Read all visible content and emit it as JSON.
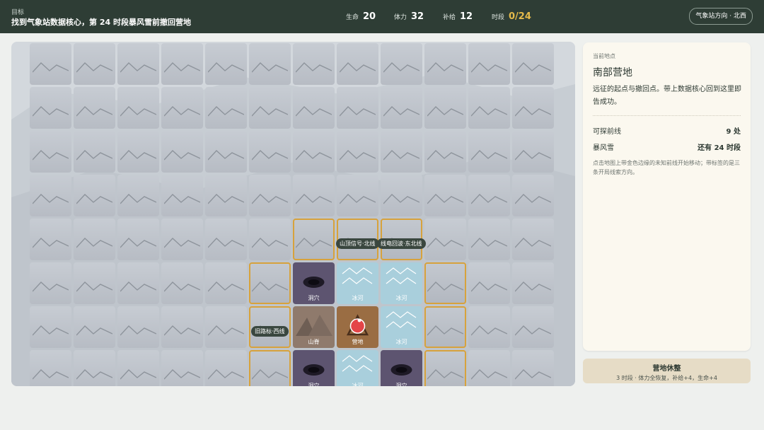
{
  "header": {
    "goal_label": "目标",
    "goal_text": "找到气象站数据核心，第 24 时段暴风雪前撤回营地",
    "stats": [
      {
        "label": "生命",
        "value": "20",
        "highlight": false
      },
      {
        "label": "体力",
        "value": "32",
        "highlight": false
      },
      {
        "label": "补给",
        "value": "12",
        "highlight": false
      },
      {
        "label": "时段",
        "value": "0/24",
        "highlight": true
      }
    ],
    "direction_hint": "气象站方向 · 北西"
  },
  "map": {
    "rows": 8,
    "cols": 12,
    "special_tiles": [
      {
        "row": 4,
        "col": 6,
        "type": "front",
        "label": ""
      },
      {
        "row": 4,
        "col": 7,
        "type": "front",
        "label": ""
      },
      {
        "row": 4,
        "col": 8,
        "type": "front",
        "label": ""
      },
      {
        "row": 5,
        "col": 5,
        "type": "front",
        "label": ""
      },
      {
        "row": 5,
        "col": 6,
        "type": "cave",
        "label": "洞穴"
      },
      {
        "row": 5,
        "col": 7,
        "type": "ice",
        "label": "冰河"
      },
      {
        "row": 5,
        "col": 8,
        "type": "ice",
        "label": "冰河"
      },
      {
        "row": 5,
        "col": 9,
        "type": "front",
        "label": ""
      },
      {
        "row": 6,
        "col": 5,
        "type": "front",
        "label": ""
      },
      {
        "row": 6,
        "col": 6,
        "type": "ridge",
        "label": "山脊"
      },
      {
        "row": 6,
        "col": 7,
        "type": "camp",
        "label": "营地"
      },
      {
        "row": 6,
        "col": 8,
        "type": "ice",
        "label": "冰河"
      },
      {
        "row": 6,
        "col": 9,
        "type": "front",
        "label": ""
      },
      {
        "row": 7,
        "col": 5,
        "type": "front",
        "label": ""
      },
      {
        "row": 7,
        "col": 6,
        "type": "cave",
        "label": "洞穴"
      },
      {
        "row": 7,
        "col": 7,
        "type": "ice",
        "label": "冰河"
      },
      {
        "row": 7,
        "col": 8,
        "type": "cave",
        "label": "洞穴"
      },
      {
        "row": 7,
        "col": 9,
        "type": "front",
        "label": ""
      }
    ],
    "clue_tags": [
      {
        "row": 4,
        "col": 7,
        "text": "山顶信号·北线"
      },
      {
        "row": 4,
        "col": 8,
        "text": "线电回波·东北线"
      },
      {
        "row": 6,
        "col": 5,
        "text": "旧路标·西线"
      }
    ]
  },
  "panel": {
    "current_label": "当前地点",
    "location": "南部营地",
    "description": "远征的起点与撤回点。带上数据核心回到这里即告成功。",
    "rows": [
      {
        "label": "可探前线",
        "value": "9 处"
      },
      {
        "label": "暴风雪",
        "value": "还有 24 时段"
      }
    ],
    "hint": "点击地图上带金色边缘的未知前线开始移动；带标签的是三条开局线索方向。"
  },
  "rest_button": {
    "title": "营地休整",
    "subtitle": "3 时段 · 体力全恢复，补给+4，生命+4"
  },
  "colors": {
    "header_bg": "#2e3d35",
    "frontier_border": "#d7a23c",
    "cave": "#5d5470",
    "ice": "#a9cfdc",
    "ridge": "#8f7a6c",
    "camp": "#9a6d43",
    "fog_tile": "#bfc4cb"
  }
}
